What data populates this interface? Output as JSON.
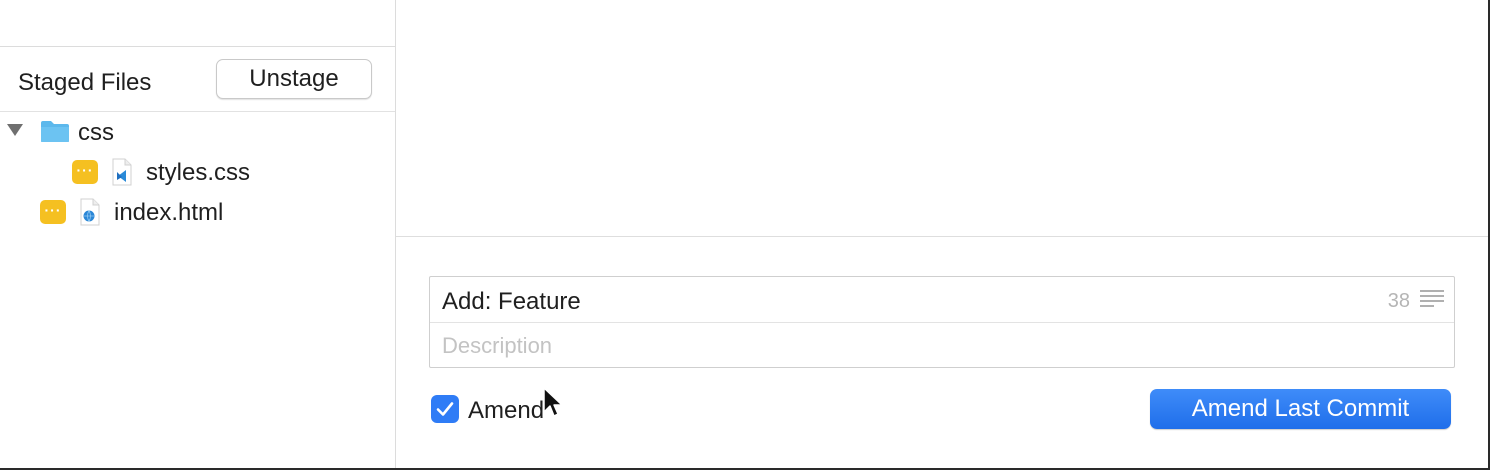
{
  "staged_panel": {
    "title": "Staged Files",
    "unstage_label": "Unstage",
    "tree": {
      "folder": {
        "name": "css",
        "expanded": true,
        "icon": "folder-icon",
        "children": [
          {
            "name": "styles.css",
            "status": "modified",
            "icon": "vscode-file-icon"
          }
        ]
      },
      "files": [
        {
          "name": "index.html",
          "status": "modified",
          "icon": "html-file-icon"
        }
      ]
    }
  },
  "commit": {
    "summary": "Add: Feature",
    "char_count": "38",
    "description_placeholder": "Description",
    "amend_label": "Amend",
    "amend_checked": true,
    "commit_button_label": "Amend Last Commit"
  },
  "colors": {
    "accent": "#2f7cf6",
    "badge_modified": "#f5c021",
    "folder": "#5cb8ec"
  }
}
